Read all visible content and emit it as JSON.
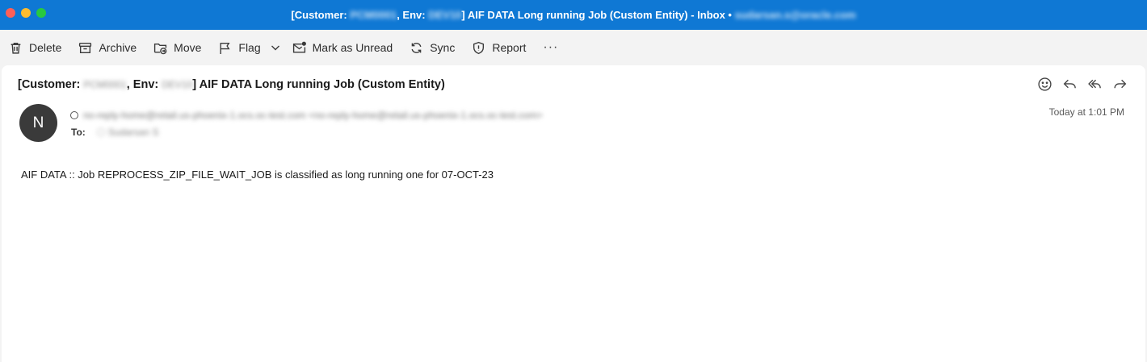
{
  "window": {
    "title_prefix": "[Customer:",
    "title_customer": "PCM0001",
    "title_env_label": ", Env:",
    "title_env": "DEV10",
    "title_suffix": "] AIF DATA Long running Job (Custom Entity) - Inbox •",
    "title_account": "sudarsan.s@oracle.com"
  },
  "toolbar": {
    "delete_label": "Delete",
    "archive_label": "Archive",
    "move_label": "Move",
    "flag_label": "Flag",
    "mark_unread_label": "Mark as Unread",
    "sync_label": "Sync",
    "report_label": "Report",
    "more_label": "···"
  },
  "message": {
    "subject_prefix": "[Customer:",
    "subject_customer": "PCM0001",
    "subject_env_label": ", Env:",
    "subject_env": "DEV10",
    "subject_suffix": "] AIF DATA Long running Job (Custom Entity)",
    "avatar_initial": "N",
    "from": "no-reply-home@retail.us-phoenix-1.ocs.oc-test.com <no-reply-home@retail.us-phoenix-1.ocs.oc-test.com>",
    "to_label": "To:",
    "to_value": "Sudarsan S",
    "timestamp": "Today at 1:01 PM",
    "body": "AIF DATA :: Job REPROCESS_ZIP_FILE_WAIT_JOB is classified as long running one for 07-OCT-23"
  },
  "icons": {
    "delete": "trash-icon",
    "archive": "archive-icon",
    "move": "folder-move-icon",
    "flag": "flag-icon",
    "mark_unread": "envelope-dot-icon",
    "sync": "sync-icon",
    "report": "shield-icon",
    "emoji": "smiley-icon",
    "reply": "reply-icon",
    "reply_all": "reply-all-icon",
    "forward": "forward-icon"
  },
  "colors": {
    "titlebar": "#0f78d4",
    "avatar": "#3a3a3a"
  }
}
